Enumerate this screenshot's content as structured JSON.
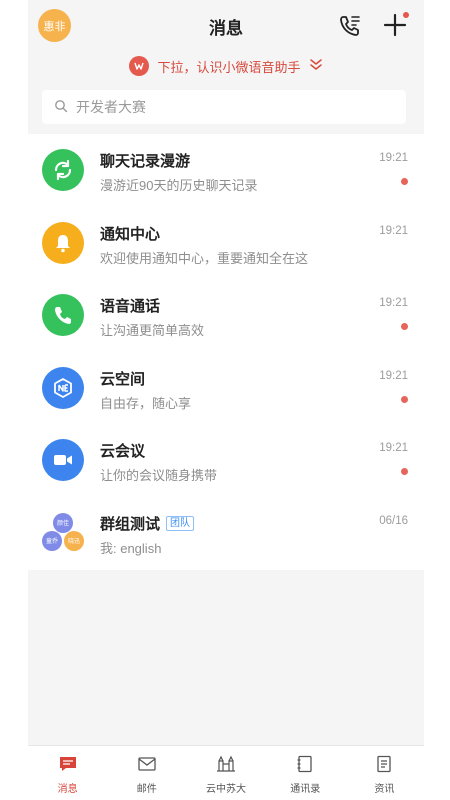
{
  "header": {
    "avatar_text": "惠非",
    "title": "消息",
    "icons": [
      "phone-icon",
      "plus-icon"
    ]
  },
  "pull_hint": {
    "text": "下拉，认识小微语音助手"
  },
  "search": {
    "placeholder": "开发者大赛"
  },
  "conversations": [
    {
      "title": "聊天记录漫游",
      "subtitle": "漫游近90天的历史聊天记录",
      "time": "19:21",
      "unread": true,
      "icon": "sync-icon",
      "color": "#35c15b"
    },
    {
      "title": "通知中心",
      "subtitle": "欢迎使用通知中心，重要通知全在这",
      "time": "19:21",
      "unread": false,
      "icon": "bell-icon",
      "color": "#f6ae1c"
    },
    {
      "title": "语音通话",
      "subtitle": "让沟通更简单高效",
      "time": "19:21",
      "unread": true,
      "icon": "phone-icon",
      "color": "#35c15b"
    },
    {
      "title": "云空间",
      "subtitle": "自由存，随心享",
      "time": "19:21",
      "unread": true,
      "icon": "cloud-box-icon",
      "color": "#3d84ee"
    },
    {
      "title": "云会议",
      "subtitle": "让你的会议随身携带",
      "time": "19:21",
      "unread": true,
      "icon": "video-icon",
      "color": "#3d84ee"
    },
    {
      "title": "群组测试",
      "tag": "团队",
      "subtitle": "我: english",
      "time": "06/16",
      "unread": false,
      "icon": "group-avatar-icon",
      "members": [
        "颜佳",
        "童乔",
        "晓迅"
      ]
    }
  ],
  "tabbar": [
    {
      "label": "消息",
      "icon": "message-icon",
      "active": true
    },
    {
      "label": "邮件",
      "icon": "mail-icon",
      "active": false
    },
    {
      "label": "云中苏大",
      "icon": "campus-icon",
      "active": false
    },
    {
      "label": "通讯录",
      "icon": "contacts-icon",
      "active": false
    },
    {
      "label": "资讯",
      "icon": "news-icon",
      "active": false
    }
  ],
  "colors": {
    "accent": "#d8443a",
    "green": "#35c15b",
    "blue": "#3d84ee",
    "orange": "#f6ae1c"
  }
}
